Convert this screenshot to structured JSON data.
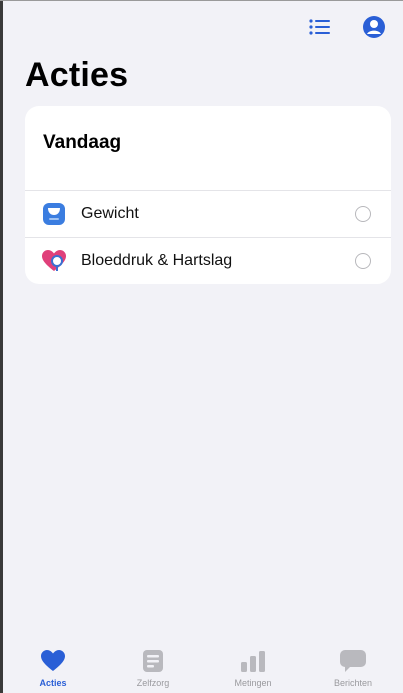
{
  "header": {
    "title": "Acties",
    "icons": [
      "list-icon",
      "profile-icon"
    ]
  },
  "today_card": {
    "title": "Vandaag",
    "items": [
      {
        "label": "Gewicht",
        "icon": "scale-icon",
        "done": false
      },
      {
        "label": "Bloeddruk & Hartslag",
        "icon": "heart-stethoscope-icon",
        "done": false
      }
    ]
  },
  "tabbar": {
    "tabs": [
      {
        "label": "Acties",
        "icon": "heart-icon",
        "active": true
      },
      {
        "label": "Zelfzorg",
        "icon": "document-icon",
        "active": false
      },
      {
        "label": "Metingen",
        "icon": "bar-chart-icon",
        "active": false
      },
      {
        "label": "Berichten",
        "icon": "chat-bubble-icon",
        "active": false
      }
    ]
  },
  "colors": {
    "accent": "#2a5fd6",
    "background": "#f2f2f7",
    "card": "#ffffff",
    "heart_pink": "#e0407a",
    "inactive": "#b9b9be"
  }
}
